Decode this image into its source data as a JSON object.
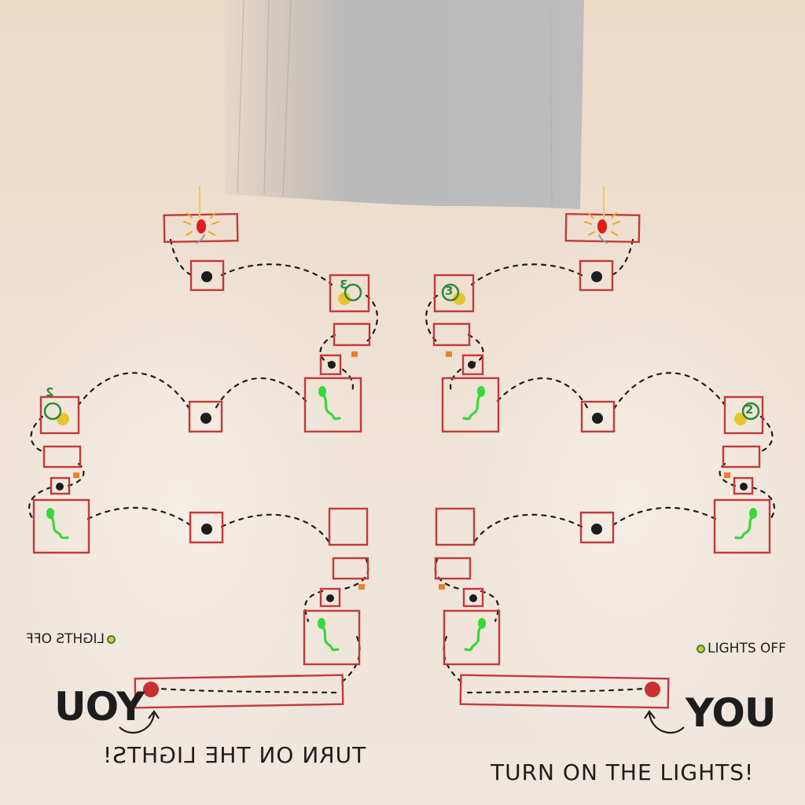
{
  "scene": {
    "colors": {
      "background": "#eee1d3",
      "box_stroke": "#c23a3a",
      "wire": "#1d1d1d",
      "bulb": "#e21b1b",
      "glow": "#f4a71e",
      "plant": "#37d83b",
      "coin_ring": "#2e8a3a",
      "coin_fill": "#e9c42f",
      "orange_marker": "#e8822a",
      "player_marker": "#c93030",
      "curtain": "#bcbcbc"
    },
    "icons": [
      "bulb-icon",
      "button-icon",
      "coin-icon",
      "sprout-icon",
      "player-marker-icon"
    ]
  },
  "left": {
    "you_label": "YOU",
    "cta": "TURN ON THE LIGHTS!",
    "lights_label": "LIGHTS OFF",
    "counter_top": "3",
    "counter_mid": "2",
    "mirrored": true
  },
  "right": {
    "you_label": "YOU",
    "cta": "TURN ON THE LIGHTS!",
    "lights_label": "LIGHTS OFF",
    "counter_top": "3",
    "counter_mid": "2",
    "mirrored": false
  }
}
